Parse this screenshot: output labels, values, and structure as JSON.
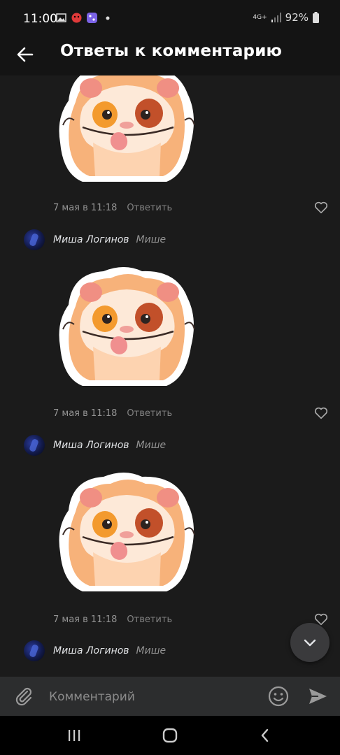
{
  "status_bar": {
    "time": "11:00",
    "network": "4G+",
    "battery": "92%"
  },
  "header": {
    "title": "Ответы к комментарию",
    "back_icon": "arrow-left-icon"
  },
  "comments": [
    {
      "date": "7 мая в 11:18",
      "reply_label": "Ответить"
    },
    {
      "author": "Миша Логинов",
      "reply_to": "Мише",
      "date": "7 мая в 11:18",
      "reply_label": "Ответить"
    },
    {
      "author": "Миша Логинов",
      "reply_to": "Мише",
      "date": "7 мая в 11:18",
      "reply_label": "Ответить"
    },
    {
      "author": "Миша Логинов",
      "reply_to": "Мише"
    }
  ],
  "composer": {
    "placeholder": "Комментарий"
  },
  "colors": {
    "background": "#1b1b1b",
    "bar": "#141414",
    "composer": "#2c2d2e",
    "text": "#e1e3e6",
    "secondary_text": "#939393"
  }
}
